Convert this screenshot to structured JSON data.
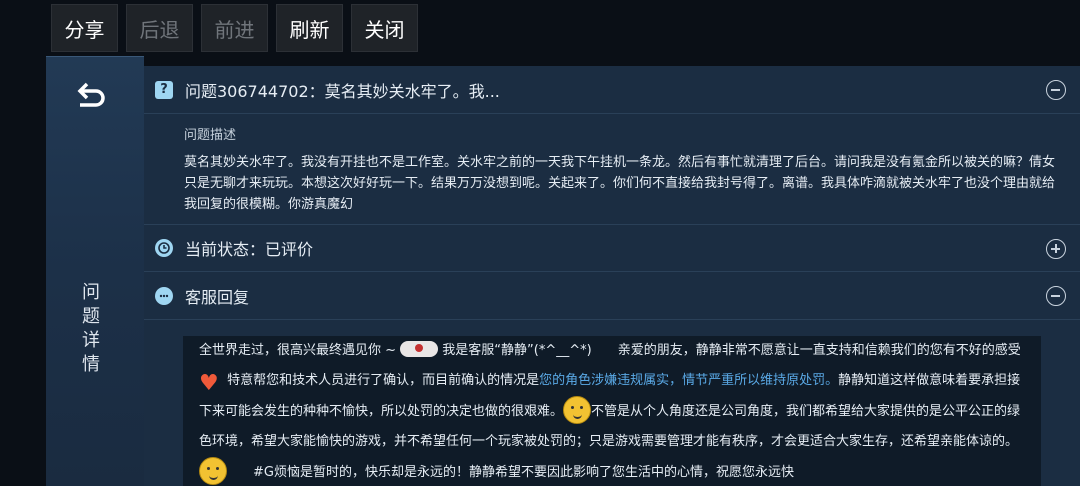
{
  "toolbar": {
    "share": "分享",
    "back": "后退",
    "forward": "前进",
    "refresh": "刷新",
    "close": "关闭"
  },
  "side": {
    "title_chars": [
      "问",
      "题",
      "详",
      "情"
    ]
  },
  "question": {
    "title": "问题306744702：莫名其妙关水牢了。我...",
    "desc_label": "问题描述",
    "desc_text": "莫名其妙关水牢了。我没有开挂也不是工作室。关水牢之前的一天我下午挂机一条龙。然后有事忙就清理了后台。请问我是没有氪金所以被关的嘛？倩女只是无聊才来玩玩。本想这次好好玩一下。结果万万没想到呢。关起来了。你们何不直接给我封号得了。离谱。我具体咋滴就被关水牢了也没个理由就给我回复的很模糊。你游真魔幻"
  },
  "status": {
    "title": "当前状态：已评价"
  },
  "reply": {
    "title": "客服回复",
    "p1": "全世界走过，很高兴最终遇见你 ~ ",
    "p2": " 我是客服“静静”(*^__^*)　　亲爱的朋友，静静非常不愿意让一直支持和信赖我们的您有不好的感受",
    "p3": "特意帮您和技术人员进行了确认，而目前确认的情况是",
    "highlight": "您的角色涉嫌违规属实，情节严重所以维持原处罚。",
    "p4": "静静知道这样做意味着要承担接下来可能会发生的种种不愉快，所以处罚的决定也做的很艰难。",
    "p5": "不管是从个人角度还是公司角度，我们都希望给大家提供的是公平公正的绿色环境，希望大家能愉快的游戏，并不希望任何一个玩家被处罚的；只是游戏需要管理才能有秩序，才会更适合大家生存，还希望亲能体谅的。",
    "p6": "　　#G烦恼是暂时的，快乐却是永远的！静静希望不要因此影响了您生活中的心情，祝愿您永远快"
  },
  "colors": {
    "panel": "#1b2d42",
    "side_panel": "#223a55",
    "highlight": "#5aa9e6",
    "icon": "#9fd6f2"
  }
}
